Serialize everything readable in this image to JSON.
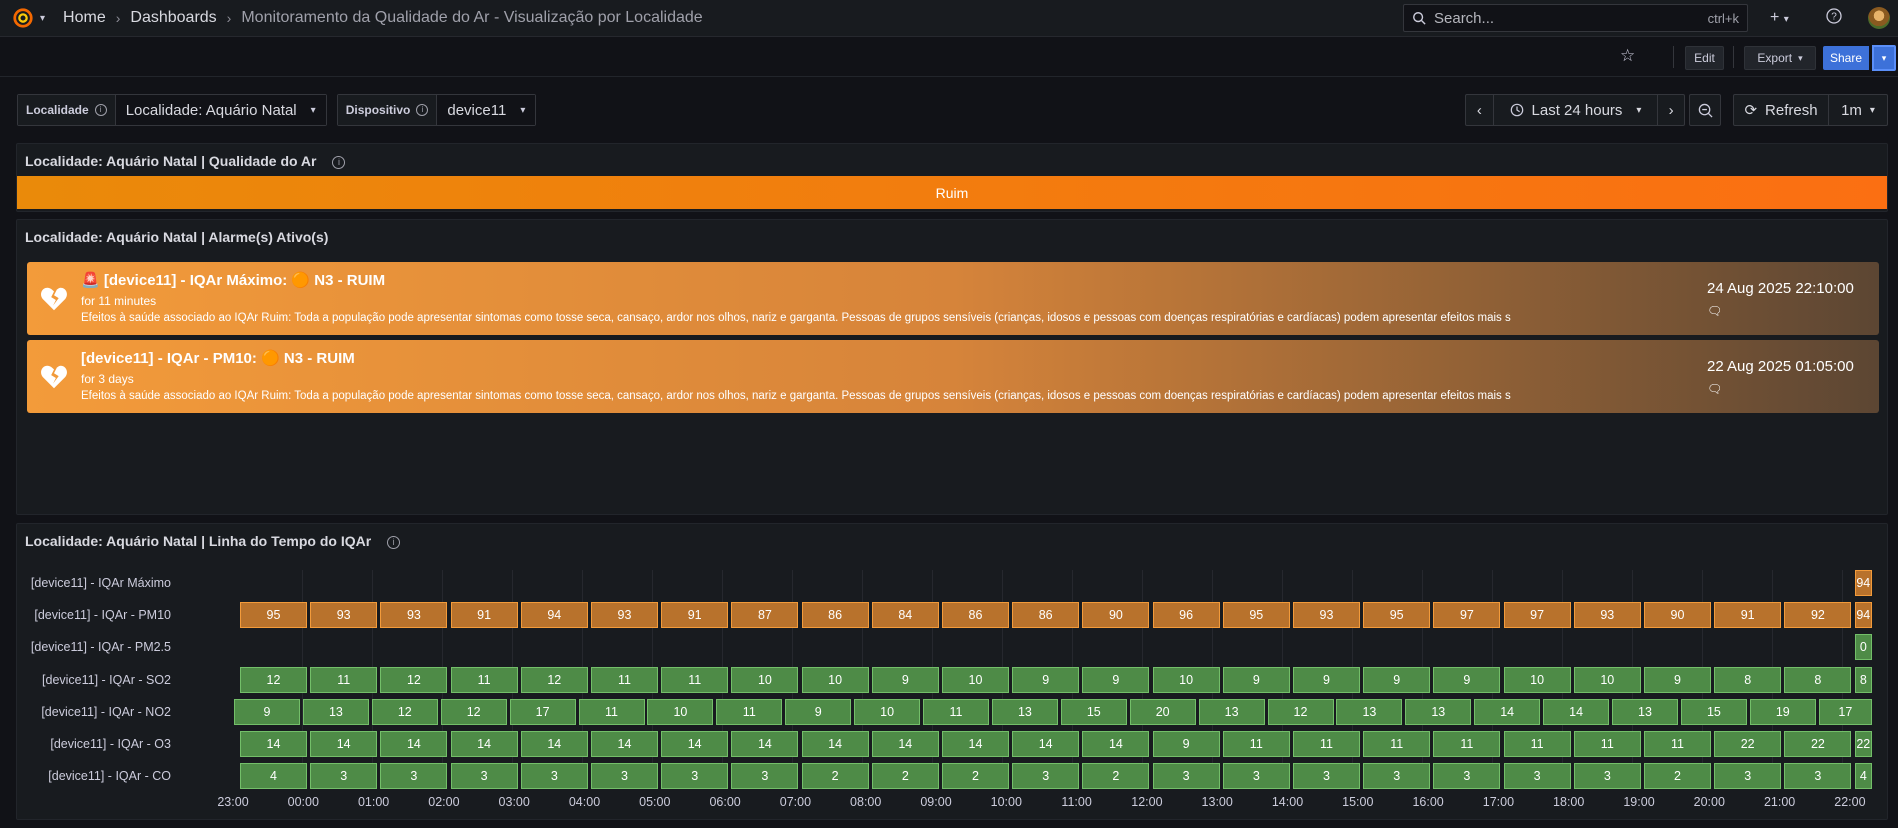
{
  "header": {
    "breadcrumbs": [
      "Home",
      "Dashboards",
      "Monitoramento da Qualidade do Ar - Visualização por Localidade"
    ],
    "search_placeholder": "Search...",
    "search_shortcut": "ctrl+k"
  },
  "toolbar": {
    "edit": "Edit",
    "export": "Export",
    "share": "Share"
  },
  "variables": [
    {
      "label": "Localidade",
      "value": "Localidade: Aquário Natal"
    },
    {
      "label": "Dispositivo",
      "value": "device11"
    }
  ],
  "time": {
    "range": "Last 24 hours",
    "refresh": "Refresh",
    "interval": "1m"
  },
  "panels": {
    "quality": {
      "title": "Localidade: Aquário Natal | Qualidade do Ar",
      "status": "Ruim"
    },
    "alarms": {
      "title": "Localidade: Aquário Natal | Alarme(s) Ativo(s)",
      "items": [
        {
          "title": "🚨 [device11] - IQAr Máximo: 🟠 N3 - RUIM",
          "for": "for 11 minutes",
          "desc": "Efeitos à saúde associado ao IQAr Ruim: Toda a população pode apresentar sintomas como tosse seca, cansaço, ardor nos olhos, nariz e garganta. Pessoas de grupos sensíveis (crianças, idosos e pessoas com doenças respiratórias e cardíacas) podem apresentar efeitos mais s",
          "time": "24 Aug 2025 22:10:00"
        },
        {
          "title": "[device11] - IQAr - PM10: 🟠 N3 - RUIM",
          "for": "for 3 days",
          "desc": "Efeitos à saúde associado ao IQAr Ruim: Toda a população pode apresentar sintomas como tosse seca, cansaço, ardor nos olhos, nariz e garganta. Pessoas de grupos sensíveis (crianças, idosos e pessoas com doenças respiratórias e cardíacas) podem apresentar efeitos mais s",
          "time": "22 Aug 2025 01:05:00"
        }
      ]
    },
    "timeline": {
      "title": "Localidade: Aquário Natal | Linha do Tempo do IQAr"
    }
  },
  "chart_data": {
    "type": "timeline",
    "x_ticks": [
      "23:00",
      "00:00",
      "01:00",
      "02:00",
      "03:00",
      "04:00",
      "05:00",
      "06:00",
      "07:00",
      "08:00",
      "09:00",
      "10:00",
      "11:00",
      "12:00",
      "13:00",
      "14:00",
      "15:00",
      "16:00",
      "17:00",
      "18:00",
      "19:00",
      "20:00",
      "21:00",
      "22:00"
    ],
    "series": [
      {
        "name": "[device11] - IQAr Máximo",
        "color": "orange",
        "start_index": 23,
        "values": [
          94
        ]
      },
      {
        "name": "[device11] - IQAr - PM10",
        "color": "orange",
        "start_index": 0,
        "values": [
          95,
          93,
          93,
          91,
          94,
          93,
          91,
          87,
          86,
          84,
          86,
          86,
          90,
          96,
          95,
          93,
          95,
          97,
          97,
          93,
          90,
          91,
          92,
          94
        ]
      },
      {
        "name": "[device11] - IQAr - PM2.5",
        "color": "green",
        "start_index": 23,
        "values": [
          0
        ]
      },
      {
        "name": "[device11] - IQAr - SO2",
        "color": "green",
        "start_index": 0,
        "values": [
          12,
          11,
          12,
          11,
          12,
          11,
          11,
          10,
          10,
          9,
          10,
          9,
          9,
          10,
          9,
          9,
          9,
          9,
          10,
          10,
          9,
          8,
          8,
          8
        ]
      },
      {
        "name": "[device11] - IQAr - NO2",
        "color": "green",
        "start_index": 0,
        "values": [
          9,
          13,
          12,
          12,
          17,
          11,
          10,
          11,
          9,
          10,
          11,
          13,
          15,
          20,
          13,
          12,
          13,
          13,
          14,
          14,
          13,
          15,
          19,
          17
        ]
      },
      {
        "name": "[device11] - IQAr - O3",
        "color": "green",
        "start_index": 0,
        "values": [
          14,
          14,
          14,
          14,
          14,
          14,
          14,
          14,
          14,
          14,
          14,
          14,
          14,
          9,
          11,
          11,
          11,
          11,
          11,
          11,
          11,
          22,
          22,
          22
        ]
      },
      {
        "name": "[device11] - IQAr - CO",
        "color": "green",
        "start_index": 0,
        "values": [
          4,
          3,
          3,
          3,
          3,
          3,
          3,
          3,
          2,
          2,
          2,
          3,
          2,
          3,
          3,
          3,
          3,
          3,
          3,
          3,
          2,
          3,
          3,
          4
        ]
      }
    ]
  }
}
